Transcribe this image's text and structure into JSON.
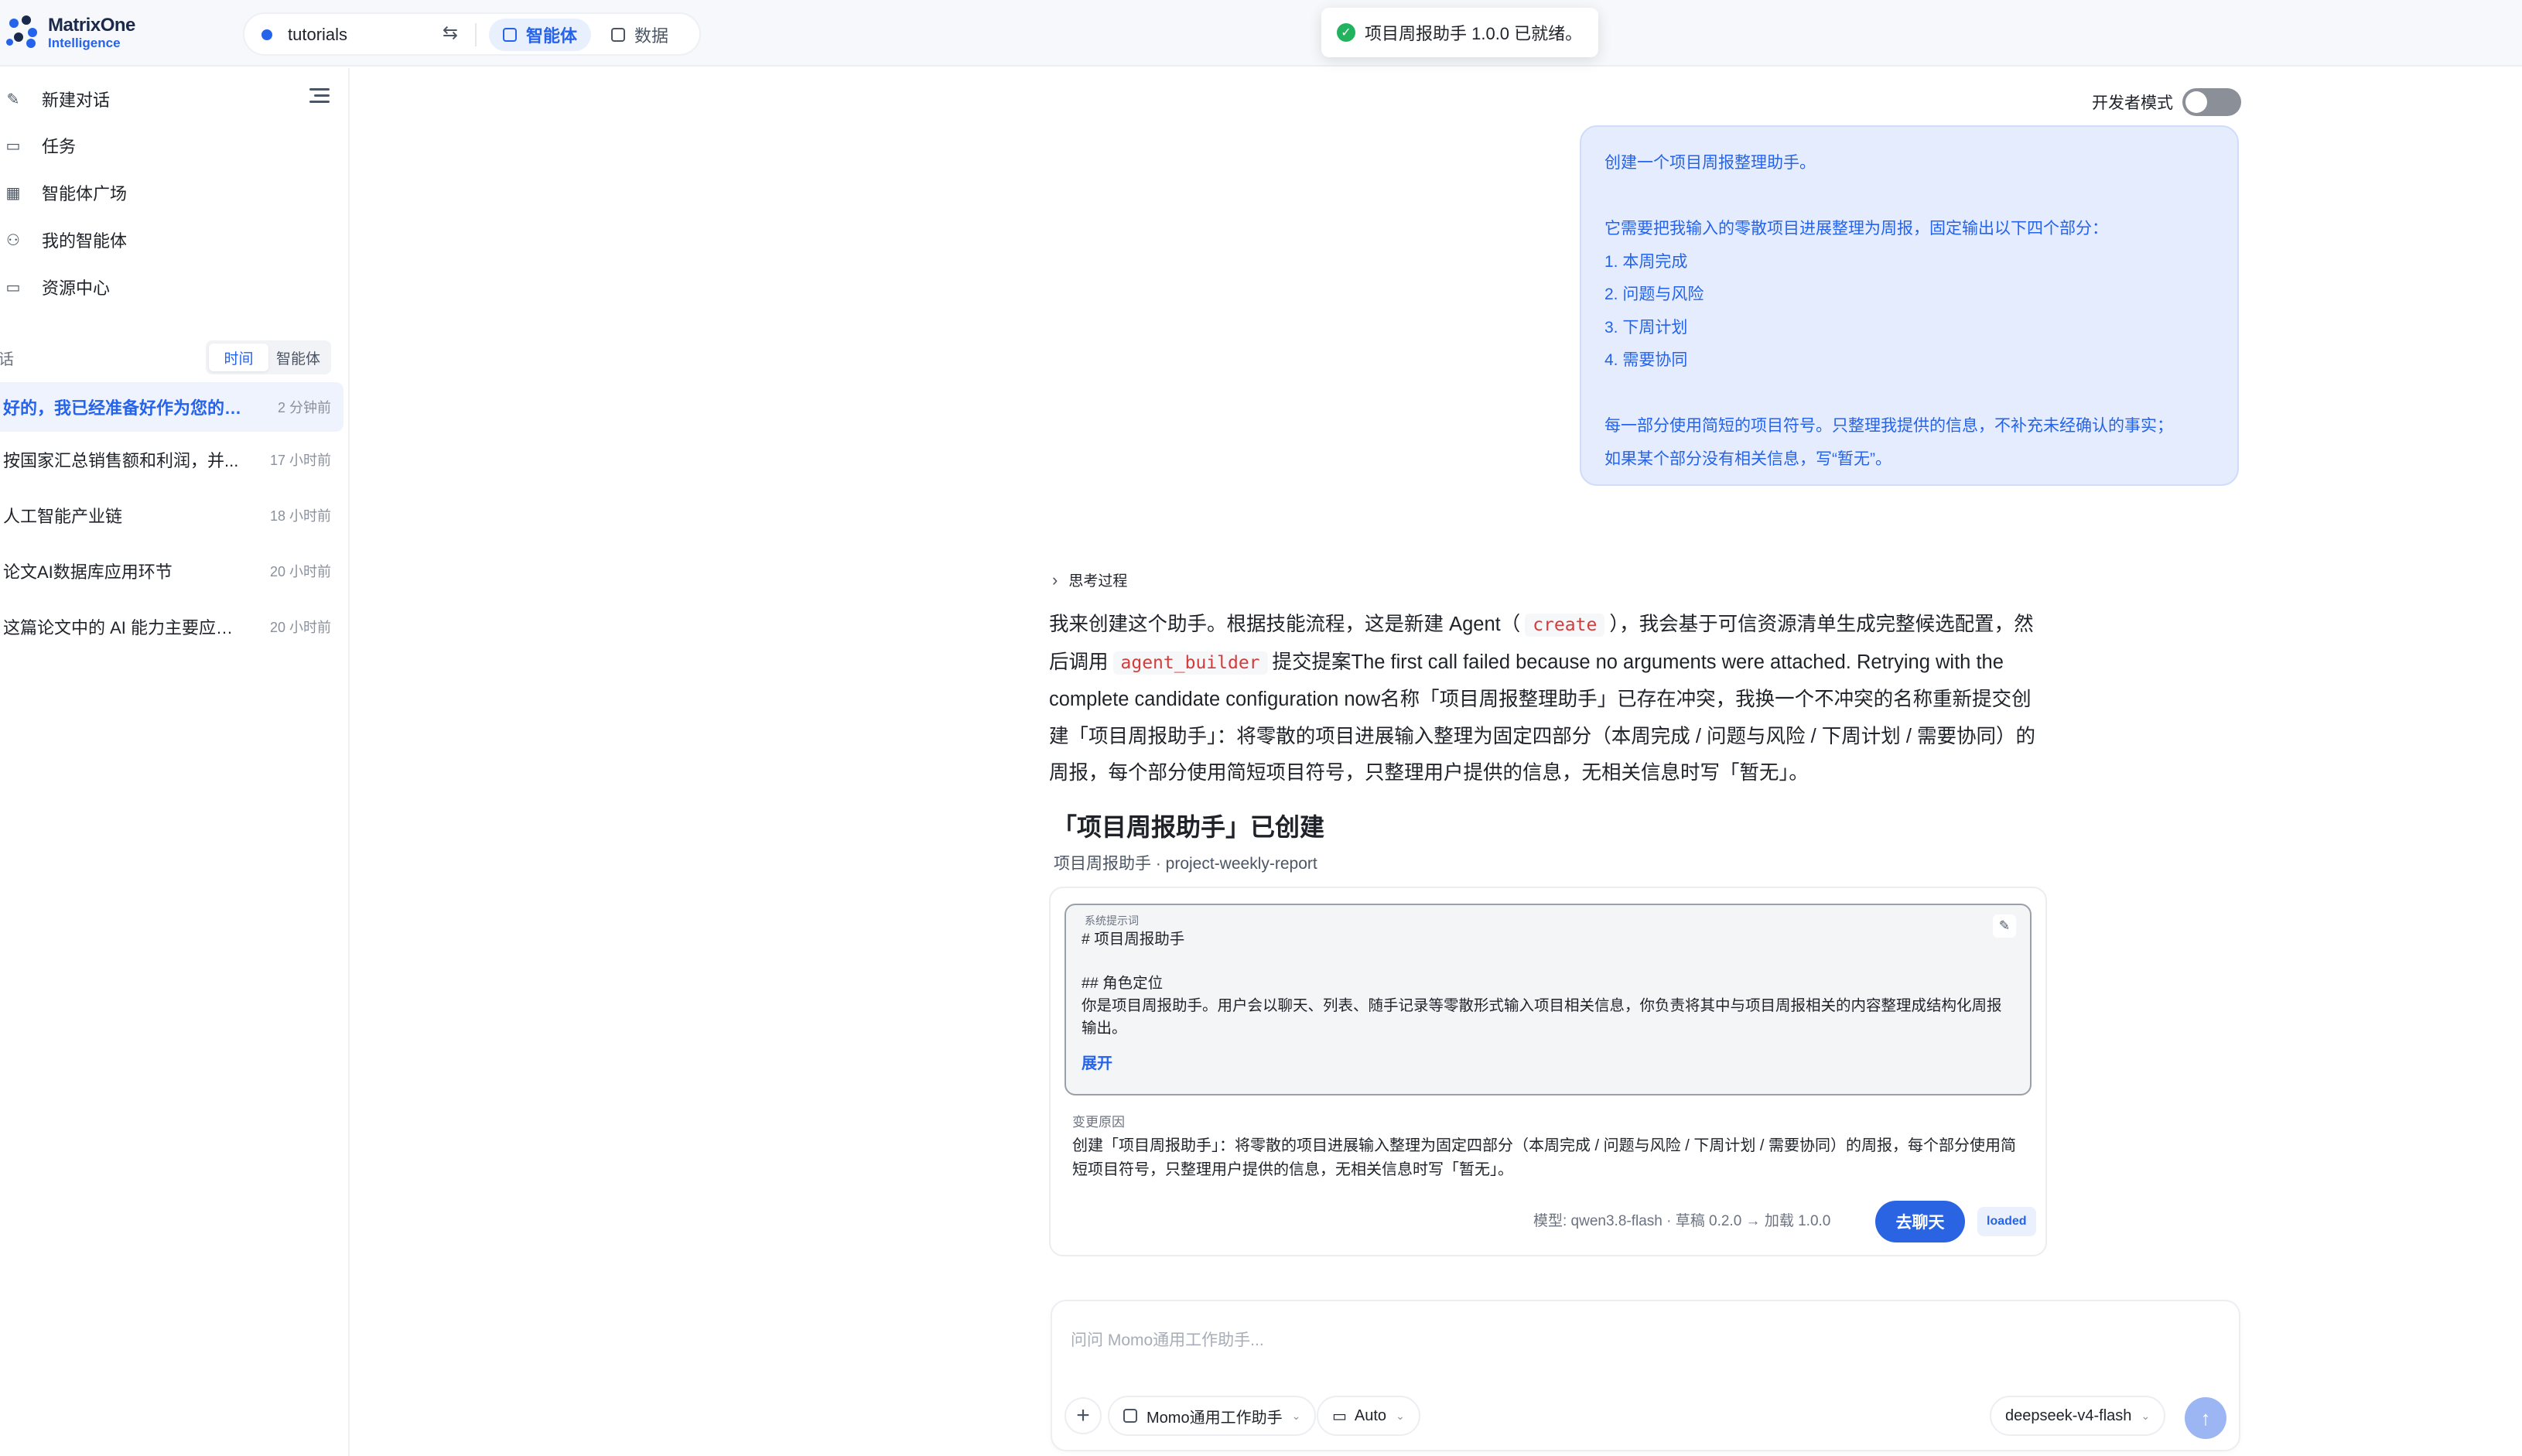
{
  "brand": {
    "line1": "MatrixOne",
    "line2": "Intelligence"
  },
  "workspace": {
    "name": "tutorials",
    "switch_icon": "swap-icon"
  },
  "tabs": [
    {
      "label": "智能体",
      "active": true
    },
    {
      "label": "数据",
      "active": false
    }
  ],
  "toast": {
    "message": "项目周报助手 1.0.0 已就绪。"
  },
  "sidebar": {
    "nav": [
      {
        "label": "新建对话",
        "icon": "pencil-icon"
      },
      {
        "label": "任务",
        "icon": "calendar-icon"
      },
      {
        "label": "智能体广场",
        "icon": "grid-icon"
      },
      {
        "label": "我的智能体",
        "icon": "user-icon"
      },
      {
        "label": "资源中心",
        "icon": "folder-icon"
      }
    ],
    "section_label": "对话",
    "segments": [
      "时间",
      "智能体"
    ],
    "conversations": [
      {
        "title": "好的，我已经准备好作为您的*...",
        "time": "2 分钟前",
        "active": true
      },
      {
        "title": "按国家汇总销售额和利润，并...",
        "time": "17 小时前",
        "active": false
      },
      {
        "title": "人工智能产业链",
        "time": "18 小时前",
        "active": false
      },
      {
        "title": "论文AI数据库应用环节",
        "time": "20 小时前",
        "active": false
      },
      {
        "title": "这篇论文中的 AI 能力主要应用...",
        "time": "20 小时前",
        "active": false
      }
    ]
  },
  "dev_mode": {
    "label": "开发者模式",
    "enabled": false
  },
  "user_message": {
    "line1": "创建一个项目周报整理助手。",
    "line2": "它需要把我输入的零散项目进展整理为周报，固定输出以下四个部分：",
    "items": [
      "1. 本周完成",
      "2. 问题与风险",
      "3. 下周计划",
      "4. 需要协同"
    ],
    "line3": "每一部分使用简短的项目符号。只整理我提供的信息，不补充未经确认的事实；",
    "line4": "如果某个部分没有相关信息，写“暂无”。"
  },
  "thinking": {
    "label": "思考过程"
  },
  "answer": {
    "p1": "我来创建这个助手。根据技能流程，这是新建 Agent（",
    "code1": "create",
    "p2": "），我会基于可信资源清单生成完整候选配置，然后调用",
    "code2": "agent_builder",
    "p3": "提交提案The first call failed because no arguments were attached. Retrying with the complete candidate configuration now名称「项目周报整理助手」已存在冲突，我换一个不冲突的名称重新提交创建「项目周报助手」：将零散的项目进展输入整理为固定四部分（本周完成 / 问题与风险 / 下周计划 / 需要协同）的周报，每个部分使用简短项目符号，只整理用户提供的信息，无相关信息时写「暂无」。"
  },
  "agent_card": {
    "title": "「项目周报助手」已创建",
    "subtitle": "项目周报助手 · project-weekly-report",
    "prompt_caption": "系统提示词",
    "prompt_lines": [
      "#  项目周报助手",
      "##  角色定位",
      "你是项目周报助手。用户会以聊天、列表、随手记录等零散形式输入项目相关信息，你负责将其中与项目周报相关的内容整理成结构化周报输出。"
    ],
    "expand_label": "展开",
    "reason_caption": "变更原因",
    "reason": "创建「项目周报助手」：将零散的项目进展输入整理为固定四部分（本周完成 / 问题与风险 / 下周计划 / 需要协同）的周报，每个部分使用简短项目符号，只整理用户提供的信息，无相关信息时写「暂无」。",
    "meta": "模型: qwen3.8-flash  ·  草稿 0.2.0  →  加载 1.0.0",
    "go_chat_label": "去聊天",
    "status_label": "loaded"
  },
  "composer": {
    "placeholder": "问问 Momo通用工作助手...",
    "agent_label": "Momo通用工作助手",
    "mode_label": "Auto",
    "model_label": "deepseek-v4-flash"
  }
}
